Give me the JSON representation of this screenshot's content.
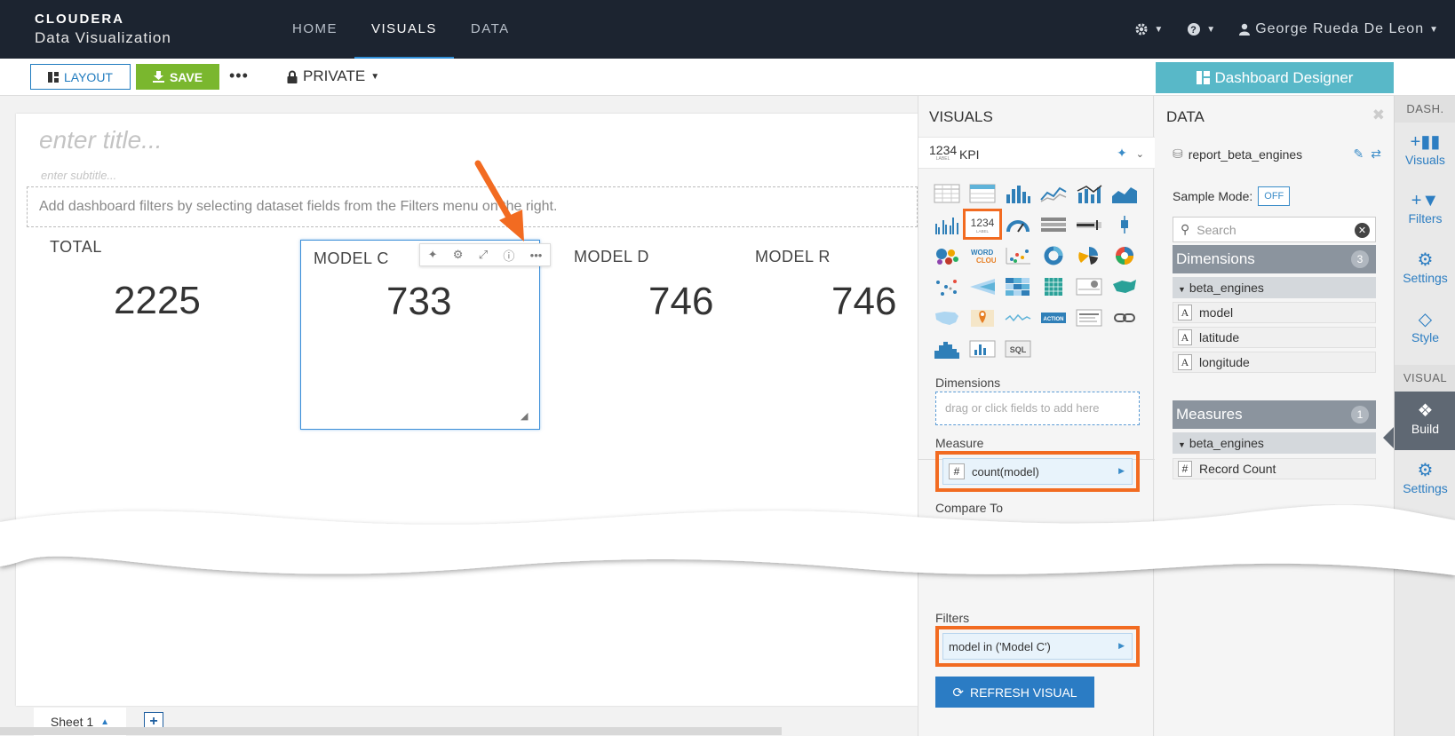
{
  "header": {
    "brand_logo": "CLOUDERA",
    "brand_product": "Data Visualization",
    "nav": [
      "HOME",
      "VISUALS",
      "DATA"
    ],
    "active_nav": "VISUALS",
    "user_name": "George Rueda De Leon"
  },
  "toolbar": {
    "layout_label": "LAYOUT",
    "save_label": "SAVE",
    "privacy_label": "PRIVATE",
    "dashboard_designer_label": "Dashboard Designer"
  },
  "canvas": {
    "title_placeholder": "enter title...",
    "subtitle_placeholder": "enter subtitle...",
    "filter_hint": "Add dashboard filters by selecting dataset fields from the Filters menu on the right.",
    "kpis": [
      {
        "label": "TOTAL",
        "value": "2225"
      },
      {
        "label": "MODEL C",
        "value": "733"
      },
      {
        "label": "MODEL D",
        "value": "746"
      },
      {
        "label": "MODEL R",
        "value": "746"
      }
    ]
  },
  "sheets": {
    "tabs": [
      "Sheet 1"
    ]
  },
  "visuals_panel": {
    "header": "VISUALS",
    "selected_visual_icon": "1234",
    "selected_visual_icon_sub": "LABEL",
    "selected_visual": "KPI",
    "grid_icons": [
      "table",
      "crosstab",
      "bars",
      "lines",
      "combo",
      "areas",
      "grouped-bars",
      "kpi",
      "gauge",
      "list",
      "bullet",
      "boxplot",
      "packed-bubbles",
      "word-cloud",
      "scatter",
      "donut",
      "radial",
      "sunburst",
      "network",
      "funnel",
      "heatmap",
      "correlation",
      "histogram-dist",
      "map-region",
      "map-interactive",
      "map-pin",
      "sparkline",
      "action",
      "rich-text",
      "links",
      "histogram",
      "extension",
      "sql"
    ],
    "action_icon_label": "ACTION",
    "sql_icon_label": "SQL",
    "dimensions_label": "Dimensions",
    "dimensions_placeholder": "drag or click fields to add here",
    "measure_label": "Measure",
    "measure_value": "count(model)",
    "compare_label": "Compare To",
    "filters_label": "Filters",
    "filter_value": "model in ('Model C')",
    "refresh_label": "REFRESH VISUAL"
  },
  "data_panel": {
    "header": "DATA",
    "dataset": "report_beta_engines",
    "sample_mode_label": "Sample Mode:",
    "sample_mode_value": "OFF",
    "search_placeholder": "Search",
    "dimensions_title": "Dimensions",
    "dimensions_count": "3",
    "dim_group": "beta_engines",
    "dimension_fields": [
      "model",
      "latitude",
      "longitude"
    ],
    "dim_field_type": "A",
    "measures_title": "Measures",
    "measures_count": "1",
    "meas_group": "beta_engines",
    "measure_fields": [
      "Record Count"
    ],
    "meas_field_type": "#"
  },
  "rail": {
    "dash_head": "DASH.",
    "dash_items": [
      "Visuals",
      "Filters",
      "Settings",
      "Style"
    ],
    "visual_head": "VISUAL",
    "visual_items": [
      "Build",
      "Settings"
    ],
    "active_item": "Build"
  },
  "colors": {
    "topbar": "#1c2430",
    "accent_blue": "#2b7cc4",
    "save_green": "#7ab72e",
    "designer_teal": "#58b8c8",
    "highlight_orange": "#f26b21"
  }
}
